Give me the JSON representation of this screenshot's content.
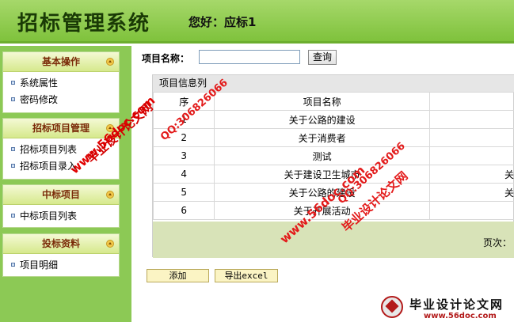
{
  "header": {
    "app_title": "招标管理系统",
    "welcome": "您好：应标1"
  },
  "sidebar": {
    "sections": [
      {
        "title": "基本操作",
        "items": [
          "系统属性",
          "密码修改"
        ]
      },
      {
        "title": "招标项目管理",
        "items": [
          "招标项目列表",
          "招标项目录入"
        ]
      },
      {
        "title": "中标项目",
        "items": [
          "中标项目列表"
        ]
      },
      {
        "title": "投标资料",
        "items": [
          "项目明细"
        ]
      }
    ]
  },
  "search": {
    "label": "项目名称：",
    "value": "",
    "button": "查询"
  },
  "panel": {
    "title": "项目信息列",
    "columns": [
      "序",
      "项目名称",
      ""
    ],
    "rows": [
      {
        "idx": "1",
        "name": "关于公路的建设",
        "extra": ""
      },
      {
        "idx": "2",
        "name": "关于消费者",
        "extra": ""
      },
      {
        "idx": "3",
        "name": "测试",
        "extra": ""
      },
      {
        "idx": "4",
        "name": "关于建设卫生城市",
        "extra": "关"
      },
      {
        "idx": "5",
        "name": "关于公路的建设",
        "extra": "关"
      },
      {
        "idx": "6",
        "name": "关于开展活动",
        "extra": ""
      }
    ],
    "pager_label": "页次："
  },
  "actions": {
    "add": "添加",
    "export": "导出excel"
  },
  "watermark": {
    "site_text": "毕业设计论文网",
    "url_text": "www.56doc.com",
    "qq_text": "QQ:306826066",
    "logo_cn": "毕业设计论文网",
    "logo_url": "www.56doc.com"
  },
  "colors": {
    "header_green": "#7fc23c",
    "sidebar_green": "#8cc955",
    "section_title": "#7a2a08",
    "watermark_red": "#e31a1a"
  }
}
